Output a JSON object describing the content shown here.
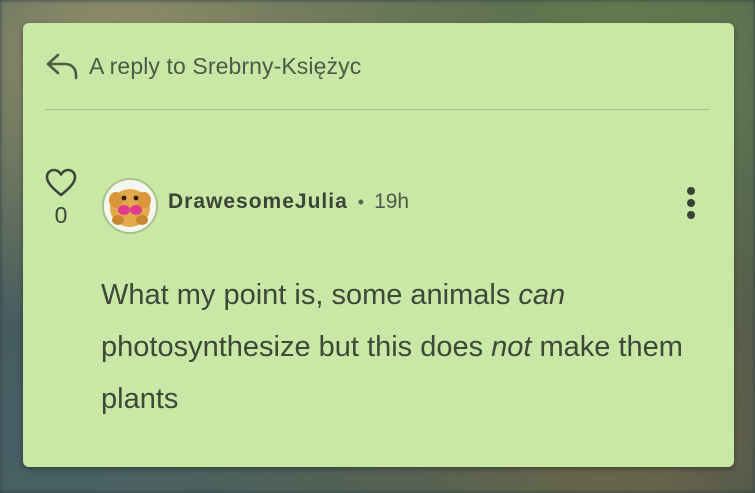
{
  "reply_header": {
    "text": "A reply to Srebrny-Księżyc",
    "icon": "reply-arrow-icon"
  },
  "like": {
    "count": "0",
    "icon": "heart-outline-icon"
  },
  "comment": {
    "author": "DrawesomeJulia",
    "separator": "•",
    "time": "19h",
    "avatar_icon": "avatar-image",
    "menu_icon": "more-vertical-icon",
    "body": {
      "part1": "What my point is, some animals ",
      "em1": "can",
      "part2": " photosynthesize but this does ",
      "em2": "not",
      "part3": " make them plants"
    }
  },
  "colors": {
    "card_background": "#c9e8a6",
    "text_primary": "#3e473a"
  }
}
